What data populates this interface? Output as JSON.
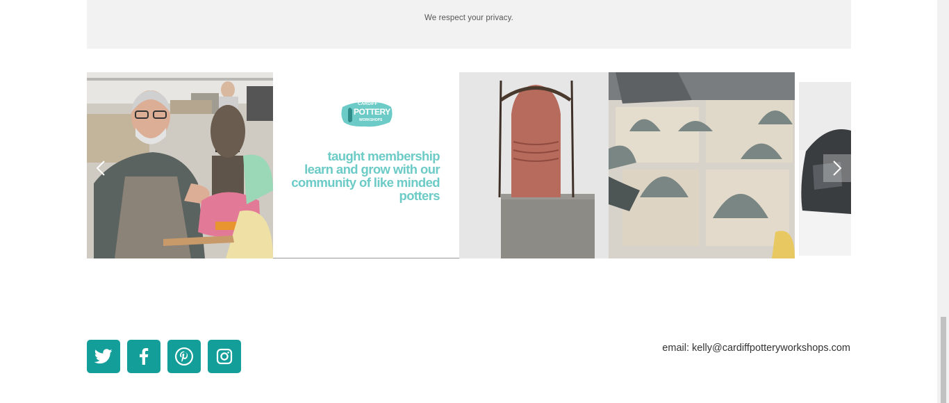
{
  "newsletter": {
    "privacy_note": "We respect your privacy."
  },
  "gallery": {
    "logo": {
      "line1": "CARDIFF",
      "line2": "POTTERY",
      "line3": "WORKSHOPS"
    },
    "promo_lines": [
      "taught membership",
      "learn and grow with our",
      "community of like minded",
      "potters"
    ],
    "prev_icon": "chevron-left-icon",
    "next_icon": "chevron-right-icon"
  },
  "footer": {
    "socials": [
      {
        "name": "twitter",
        "icon": "twitter-icon"
      },
      {
        "name": "facebook",
        "icon": "facebook-icon"
      },
      {
        "name": "pinterest",
        "icon": "pinterest-icon"
      },
      {
        "name": "instagram",
        "icon": "instagram-icon"
      }
    ],
    "email_label": "email:",
    "email_address": "kelly@cardiffpotteryworkshops.com"
  },
  "colors": {
    "accent": "#139e9a",
    "promo_text": "#6ccbc6",
    "panel_bg": "#f2f2f2"
  }
}
